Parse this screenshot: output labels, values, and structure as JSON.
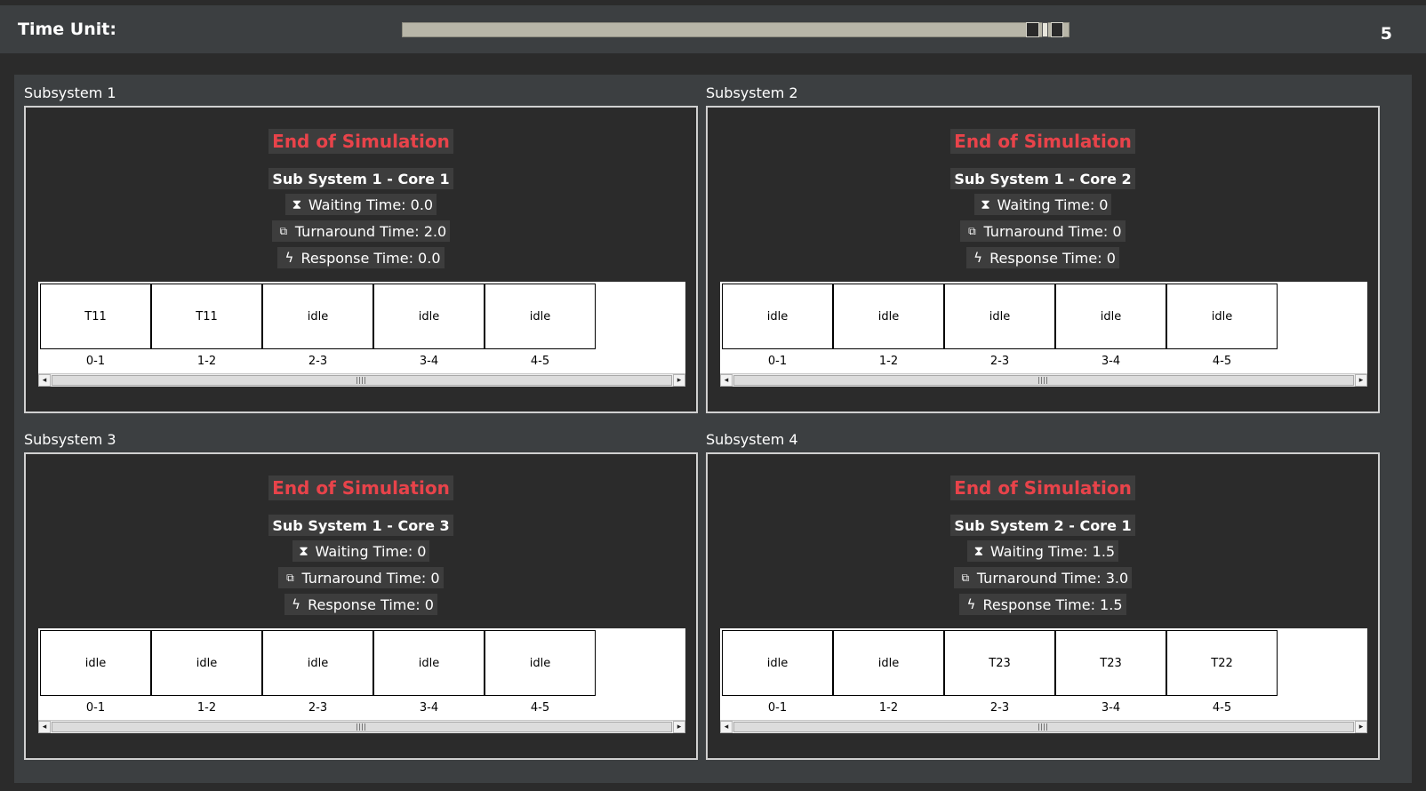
{
  "time_unit": {
    "label": "Time Unit:",
    "value": "5",
    "slider_position": 0.97
  },
  "panels": [
    {
      "title": "Subsystem 1",
      "status": "End of Simulation",
      "core": "Sub System 1 - Core 1",
      "waiting": "Waiting Time: 0.0",
      "turnaround": "Turnaround Time: 2.0",
      "response": "Response Time: 0.0",
      "cells": [
        "T11",
        "T11",
        "idle",
        "idle",
        "idle"
      ],
      "ticks": [
        "0-1",
        "1-2",
        "2-3",
        "3-4",
        "4-5"
      ]
    },
    {
      "title": "Subsystem 2",
      "status": "End of Simulation",
      "core": "Sub System 1 - Core 2",
      "waiting": "Waiting Time: 0",
      "turnaround": "Turnaround Time: 0",
      "response": "Response Time: 0",
      "cells": [
        "idle",
        "idle",
        "idle",
        "idle",
        "idle"
      ],
      "ticks": [
        "0-1",
        "1-2",
        "2-3",
        "3-4",
        "4-5"
      ]
    },
    {
      "title": "Subsystem 3",
      "status": "End of Simulation",
      "core": "Sub System 1 - Core 3",
      "waiting": "Waiting Time: 0",
      "turnaround": "Turnaround Time: 0",
      "response": "Response Time: 0",
      "cells": [
        "idle",
        "idle",
        "idle",
        "idle",
        "idle"
      ],
      "ticks": [
        "0-1",
        "1-2",
        "2-3",
        "3-4",
        "4-5"
      ]
    },
    {
      "title": "Subsystem 4",
      "status": "End of Simulation",
      "core": "Sub System 2 - Core 1",
      "waiting": "Waiting Time: 1.5",
      "turnaround": "Turnaround Time: 3.0",
      "response": "Response Time: 1.5",
      "cells": [
        "idle",
        "idle",
        "T23",
        "T23",
        "T22"
      ],
      "ticks": [
        "0-1",
        "1-2",
        "2-3",
        "3-4",
        "4-5"
      ]
    }
  ],
  "icons": {
    "waiting": "hourglass-icon",
    "turnaround": "turnaround-icon",
    "response": "lightning-icon"
  },
  "colors": {
    "status": "#e8434a",
    "background": "#2b2b2b",
    "panel": "#3c3f41"
  }
}
